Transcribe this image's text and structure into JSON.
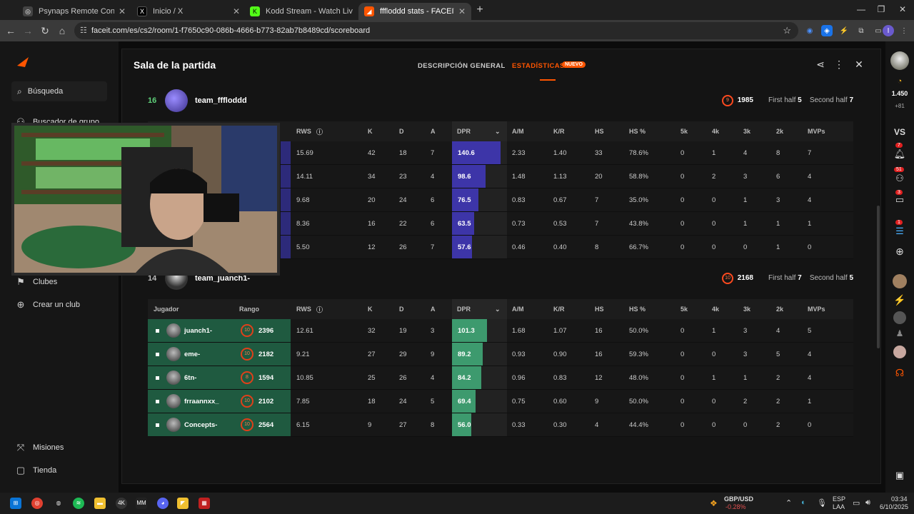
{
  "browser": {
    "tabs": [
      {
        "title": "Psynaps Remote Control",
        "active": false
      },
      {
        "title": "Inicio / X",
        "active": false
      },
      {
        "title": "Kodd Stream - Watch Live on K",
        "active": false
      },
      {
        "title": "fffloddd stats - FACEIT.com",
        "active": true
      }
    ],
    "url": "faceit.com/es/cs2/room/1-f7650c90-086b-4666-b773-82ab7b8489cd/scoreboard"
  },
  "sidebar": {
    "search_label": "Búsqueda",
    "items": [
      "Buscador de grupo",
      "Clubes",
      "Crear un club",
      "Misiones",
      "Tienda"
    ]
  },
  "modal": {
    "title": "Sala de la partida",
    "tab_overview": "DESCRIPCIÓN GENERAL",
    "tab_stats": "ESTADÍSTICAS",
    "badge_new": "NUEVO"
  },
  "columns": [
    "Jugador",
    "Rango",
    "RWS",
    "K",
    "D",
    "A",
    "DPR",
    "A/M",
    "K/R",
    "HS",
    "HS %",
    "5k",
    "4k",
    "3k",
    "2k",
    "MVPs"
  ],
  "teams": [
    {
      "score": "16",
      "name": "team_fffloddd",
      "level": "9",
      "elo": "1985",
      "first_half_label": "First half",
      "first_half": "5",
      "second_half_label": "Second half",
      "second_half": "7",
      "players": [
        {
          "rws": "15.69",
          "k": "42",
          "d": "18",
          "a": "7",
          "dpr": "140.6",
          "am": "2.33",
          "kr": "1.40",
          "hs": "33",
          "hsp": "78.6%",
          "k5": "0",
          "k4": "1",
          "k3": "4",
          "k2": "8",
          "mvps": "7"
        },
        {
          "rws": "14.11",
          "k": "34",
          "d": "23",
          "a": "4",
          "dpr": "98.6",
          "am": "1.48",
          "kr": "1.13",
          "hs": "20",
          "hsp": "58.8%",
          "k5": "0",
          "k4": "2",
          "k3": "3",
          "k2": "6",
          "mvps": "4"
        },
        {
          "rws": "9.68",
          "k": "20",
          "d": "24",
          "a": "6",
          "dpr": "76.5",
          "am": "0.83",
          "kr": "0.67",
          "hs": "7",
          "hsp": "35.0%",
          "k5": "0",
          "k4": "0",
          "k3": "1",
          "k2": "3",
          "mvps": "4"
        },
        {
          "rws": "8.36",
          "k": "16",
          "d": "22",
          "a": "6",
          "dpr": "63.5",
          "am": "0.73",
          "kr": "0.53",
          "hs": "7",
          "hsp": "43.8%",
          "k5": "0",
          "k4": "0",
          "k3": "1",
          "k2": "1",
          "mvps": "1"
        },
        {
          "rws": "5.50",
          "k": "12",
          "d": "26",
          "a": "7",
          "dpr": "57.6",
          "am": "0.46",
          "kr": "0.40",
          "hs": "8",
          "hsp": "66.7%",
          "k5": "0",
          "k4": "0",
          "k3": "0",
          "k2": "1",
          "mvps": "0"
        }
      ]
    },
    {
      "score": "14",
      "name": "team_juanch1-",
      "level": "10",
      "elo": "2168",
      "first_half_label": "First half",
      "first_half": "7",
      "second_half_label": "Second half",
      "second_half": "5",
      "players": [
        {
          "name": "juanch1-",
          "level": "10",
          "elo": "2396",
          "rws": "12.61",
          "k": "32",
          "d": "19",
          "a": "3",
          "dpr": "101.3",
          "am": "1.68",
          "kr": "1.07",
          "hs": "16",
          "hsp": "50.0%",
          "k5": "0",
          "k4": "1",
          "k3": "3",
          "k2": "4",
          "mvps": "5"
        },
        {
          "name": "eme-",
          "level": "10",
          "elo": "2182",
          "rws": "9.21",
          "k": "27",
          "d": "29",
          "a": "9",
          "dpr": "89.2",
          "am": "0.93",
          "kr": "0.90",
          "hs": "16",
          "hsp": "59.3%",
          "k5": "0",
          "k4": "0",
          "k3": "3",
          "k2": "5",
          "mvps": "4"
        },
        {
          "name": "6tn-",
          "level": "8",
          "elo": "1594",
          "rws": "10.85",
          "k": "25",
          "d": "26",
          "a": "4",
          "dpr": "84.2",
          "am": "0.96",
          "kr": "0.83",
          "hs": "12",
          "hsp": "48.0%",
          "k5": "0",
          "k4": "1",
          "k3": "1",
          "k2": "2",
          "mvps": "4"
        },
        {
          "name": "frraannxx_",
          "level": "10",
          "elo": "2102",
          "rws": "7.85",
          "k": "18",
          "d": "24",
          "a": "5",
          "dpr": "69.4",
          "am": "0.75",
          "kr": "0.60",
          "hs": "9",
          "hsp": "50.0%",
          "k5": "0",
          "k4": "0",
          "k3": "2",
          "k2": "2",
          "mvps": "1"
        },
        {
          "name": "Concepts-",
          "level": "10",
          "elo": "2564",
          "rws": "6.15",
          "k": "9",
          "d": "27",
          "a": "8",
          "dpr": "56.0",
          "am": "0.33",
          "kr": "0.30",
          "hs": "4",
          "hsp": "44.4%",
          "k5": "0",
          "k4": "0",
          "k3": "0",
          "k2": "2",
          "mvps": "0"
        }
      ]
    }
  ],
  "right_rail": {
    "elo": "1.450",
    "elo_delta": "+81",
    "vs_label": "VS",
    "notif_badges": [
      "7",
      "51",
      "3",
      "1"
    ]
  },
  "taskbar": {
    "ticker_name": "GBP/USD",
    "ticker_change": "-0.28%",
    "lang": "ESP",
    "lang_sub": "LAA",
    "time": "03:34",
    "date": "6/10/2025"
  },
  "colors": {
    "accent": "#ff5500",
    "team1_dpr": "#3d35a8",
    "team2_dpr": "#3d9a6e",
    "team2_row": "#1f5a40"
  }
}
